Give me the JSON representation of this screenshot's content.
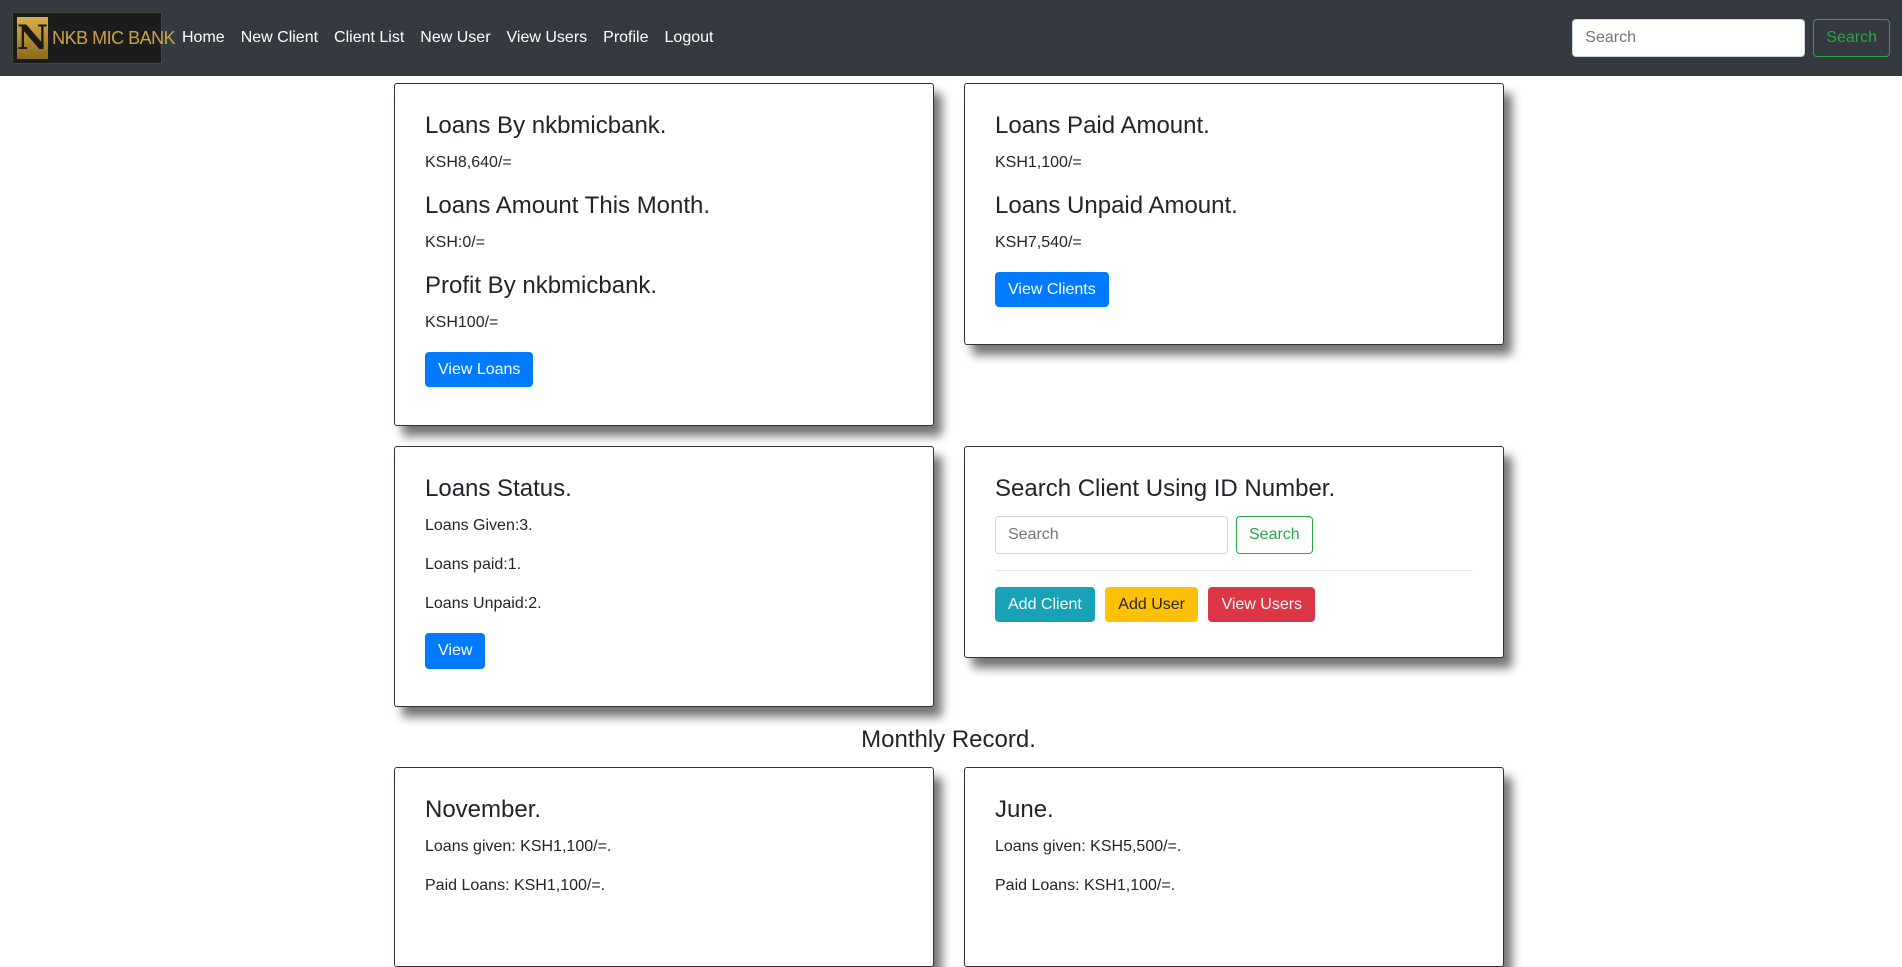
{
  "brand": {
    "logo_letter": "N",
    "name": "NKB MIC BANK"
  },
  "nav": {
    "links": [
      "Home",
      "New Client",
      "Client List",
      "New User",
      "View Users",
      "Profile",
      "Logout"
    ],
    "search_placeholder": "Search",
    "search_button": "Search"
  },
  "cards": {
    "loans_summary": {
      "loans_by_heading": "Loans By nkbmicbank.",
      "loans_by_value": "KSH8,640/=",
      "month_heading": "Loans Amount This Month.",
      "month_value": "KSH:0/=",
      "profit_heading": "Profit By nkbmicbank.",
      "profit_value": "KSH100/=",
      "button": "View Loans"
    },
    "paid_unpaid": {
      "paid_heading": "Loans Paid Amount.",
      "paid_value": "KSH1,100/=",
      "unpaid_heading": "Loans Unpaid Amount.",
      "unpaid_value": "KSH7,540/=",
      "button": "View Clients"
    },
    "status": {
      "heading": "Loans Status.",
      "given": "Loans Given:3.",
      "paid": "Loans paid:1.",
      "unpaid": "Loans Unpaid:2.",
      "button": "View"
    },
    "search_client": {
      "heading": "Search Client Using ID Number.",
      "placeholder": "Search",
      "search_button": "Search",
      "add_client": "Add Client",
      "add_user": "Add User",
      "view_users": "View Users"
    }
  },
  "monthly": {
    "title": "Monthly Record.",
    "months": [
      {
        "name": "November.",
        "loans_given": "Loans given: KSH1,100/=.",
        "paid_loans": "Paid Loans: KSH1,100/=."
      },
      {
        "name": "June.",
        "loans_given": "Loans given: KSH5,500/=.",
        "paid_loans": "Paid Loans: KSH1,100/=."
      }
    ]
  }
}
